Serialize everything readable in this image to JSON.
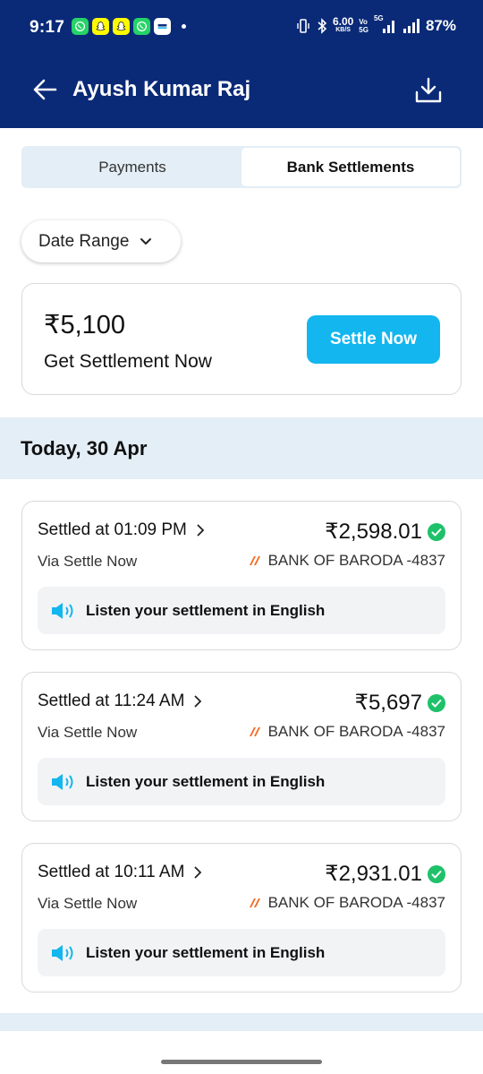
{
  "status_bar": {
    "time": "9:17",
    "speed": "6.00",
    "speed_unit": "KB/S",
    "volte": "Vo\n5G",
    "network": "5G",
    "battery": "87%"
  },
  "header": {
    "title": "Ayush Kumar Raj"
  },
  "tabs": [
    {
      "label": "Payments",
      "active": false
    },
    {
      "label": "Bank Settlements",
      "active": true
    }
  ],
  "filter": {
    "date_range_label": "Date Range"
  },
  "settle_card": {
    "amount": "₹5,100",
    "subtitle": "Get Settlement Now",
    "button_label": "Settle Now"
  },
  "section": {
    "date_label": "Today, 30 Apr"
  },
  "settlements": [
    {
      "time_label": "Settled at 01:09 PM",
      "amount": "₹2,598.01",
      "via": "Via Settle Now",
      "bank": "BANK OF BARODA -4837",
      "listen_label": "Listen your settlement in English"
    },
    {
      "time_label": "Settled at 11:24 AM",
      "amount": "₹5,697",
      "via": "Via Settle Now",
      "bank": "BANK OF BARODA -4837",
      "listen_label": "Listen your settlement in English"
    },
    {
      "time_label": "Settled at 10:11 AM",
      "amount": "₹2,931.01",
      "via": "Via Settle Now",
      "bank": "BANK OF BARODA -4837",
      "listen_label": "Listen your settlement in English"
    }
  ],
  "colors": {
    "header_bg": "#0a2a78",
    "accent": "#13b6ee",
    "success": "#1ec16a",
    "section_bg": "#e3eef6"
  }
}
